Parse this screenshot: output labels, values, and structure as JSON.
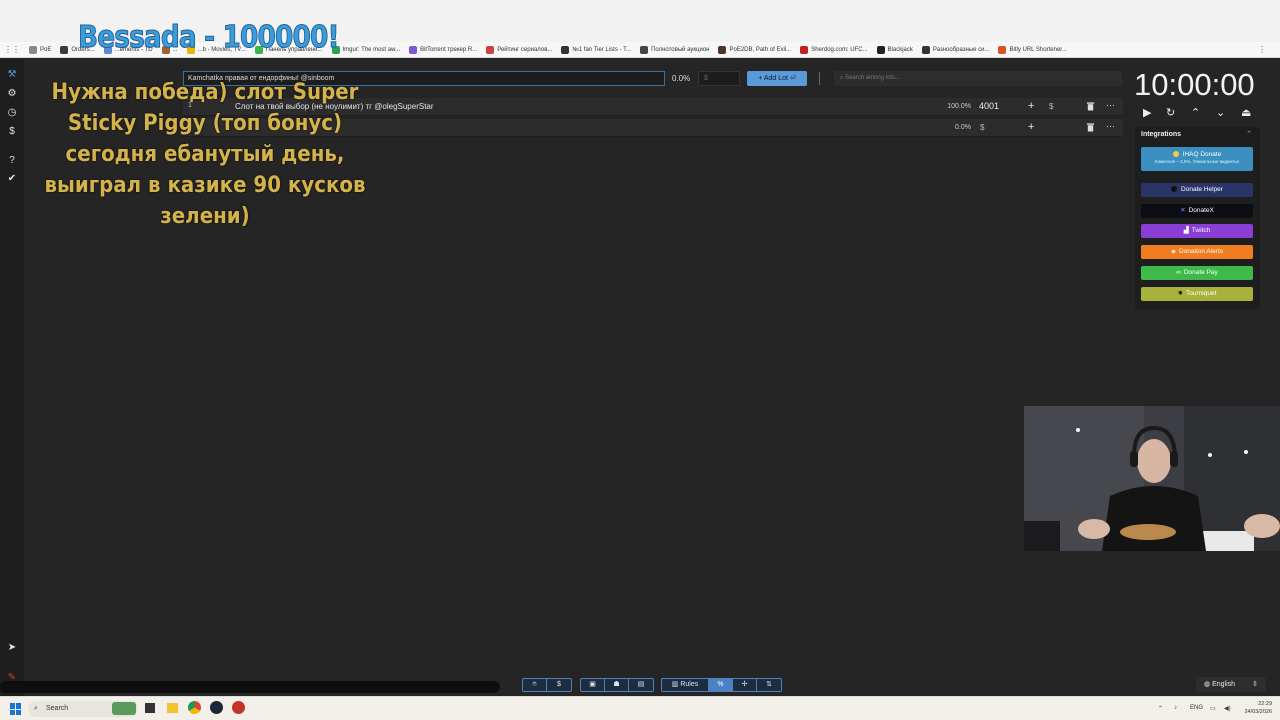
{
  "overlay": {
    "title": "Bessada - 100000!",
    "message": "Нужна победа) слот Super Sticky Piggy (топ бонус) сегодня ебанутый день, выиграл в казике 90 кусков зелени)"
  },
  "bookmarks": [
    {
      "label": "PoE",
      "color": "#e0a030"
    },
    {
      "label": "Orders...",
      "color": "#3a3a3a"
    },
    {
      "label": "...ements - TD",
      "color": "#5a8ad0"
    },
    {
      "label": "...",
      "color": "#a06030"
    },
    {
      "label": "...b - Movies, TV...",
      "color": "#e6b800"
    },
    {
      "label": "Панель управлени...",
      "color": "#3ab84a"
    },
    {
      "label": "Imgur: The most aw...",
      "color": "#2ea44f"
    },
    {
      "label": "BitTorrent трекер R...",
      "color": "#7a5ad0"
    },
    {
      "label": "Рейтинг сериалов...",
      "color": "#d04040"
    },
    {
      "label": "№1 fan Tier Lists - T...",
      "color": "#333333"
    },
    {
      "label": "Полнотовый аукцион",
      "color": "#444444"
    },
    {
      "label": "PoE2DB, Path of Exil...",
      "color": "#553322"
    },
    {
      "label": "Sherdog.com: UFC...",
      "color": "#c02020"
    },
    {
      "label": "Blackjack",
      "color": "#222222"
    },
    {
      "label": "Разнообразные си...",
      "color": "#333333"
    },
    {
      "label": "Bitly URL Shortener...",
      "color": "#e05020"
    }
  ],
  "toolbar": {
    "lot_input_value": "Kamchatka правая от ендорфины! @sinboom",
    "percent": "0.0%",
    "amount_placeholder": "$",
    "add_lot_label": "Add Lot",
    "search_placeholder": "Search among lots..."
  },
  "lots": [
    {
      "num": "1",
      "name": "Слот на твой выбор (не ноулимит) тг @olegSuperStar",
      "percent": "100.0%",
      "amount": "4001",
      "currency": "$"
    },
    {
      "num": "",
      "name": "",
      "percent": "0.0%",
      "amount": "",
      "currency": "$"
    }
  ],
  "timer": {
    "value": "10:00:00"
  },
  "integrations": {
    "title": "Integrations",
    "buttons": [
      {
        "label": "IHAQ Donate",
        "sub": "Комиссия – 3,5%. Уникальные виджеты!",
        "color": "#3a8fc0"
      },
      {
        "label": "Donate Helper",
        "color": "#2b3466"
      },
      {
        "label": "DonateX",
        "color": "#0d0d16"
      },
      {
        "label": "Twitch",
        "color": "#8a3fd4"
      },
      {
        "label": "Donation Alerts",
        "color": "#f07d1f"
      },
      {
        "label": "Donate Pay",
        "color": "#3fba4a"
      },
      {
        "label": "Tourniquet",
        "color": "#a8b23a"
      }
    ]
  },
  "bottom_tools": {
    "rules_label": "Rules"
  },
  "language": {
    "label": "English"
  },
  "taskbar": {
    "search_label": "Search",
    "lang": "ENG",
    "time": "22:29",
    "date": "24/03/2026"
  }
}
